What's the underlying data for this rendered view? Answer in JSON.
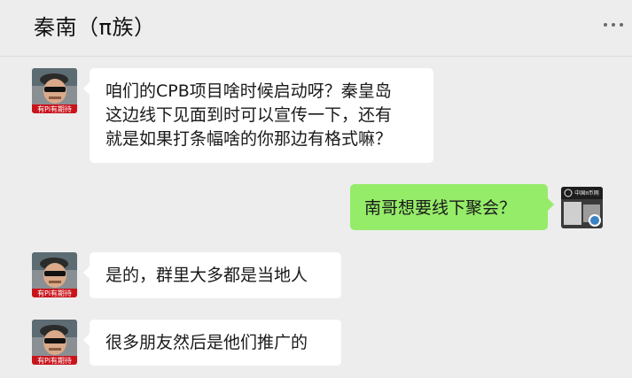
{
  "header": {
    "title": "秦南（π族）",
    "more_icon": "more-dots-icon"
  },
  "messages": [
    {
      "side": "left",
      "avatar_caption": "有Pi有期待",
      "lines": [
        "咱们的CPB项目啥时候启动呀？秦皇岛",
        "这边线下见面到时可以宣传一下，还有",
        "就是如果打条幅啥的你那边有格式嘛？"
      ]
    },
    {
      "side": "right",
      "avatar_caption": "中国π币网",
      "lines": [
        "南哥想要线下聚会？"
      ]
    },
    {
      "side": "left",
      "avatar_caption": "有Pi有期待",
      "lines": [
        "是的，群里大多都是当地人"
      ]
    },
    {
      "side": "left",
      "avatar_caption": "有Pi有期待",
      "lines": [
        "很多朋友然后是他们推广的"
      ]
    }
  ],
  "colors": {
    "background": "#ededed",
    "bubble_left": "#ffffff",
    "bubble_right": "#95ec69",
    "avatar_banner": "#c9141c"
  }
}
